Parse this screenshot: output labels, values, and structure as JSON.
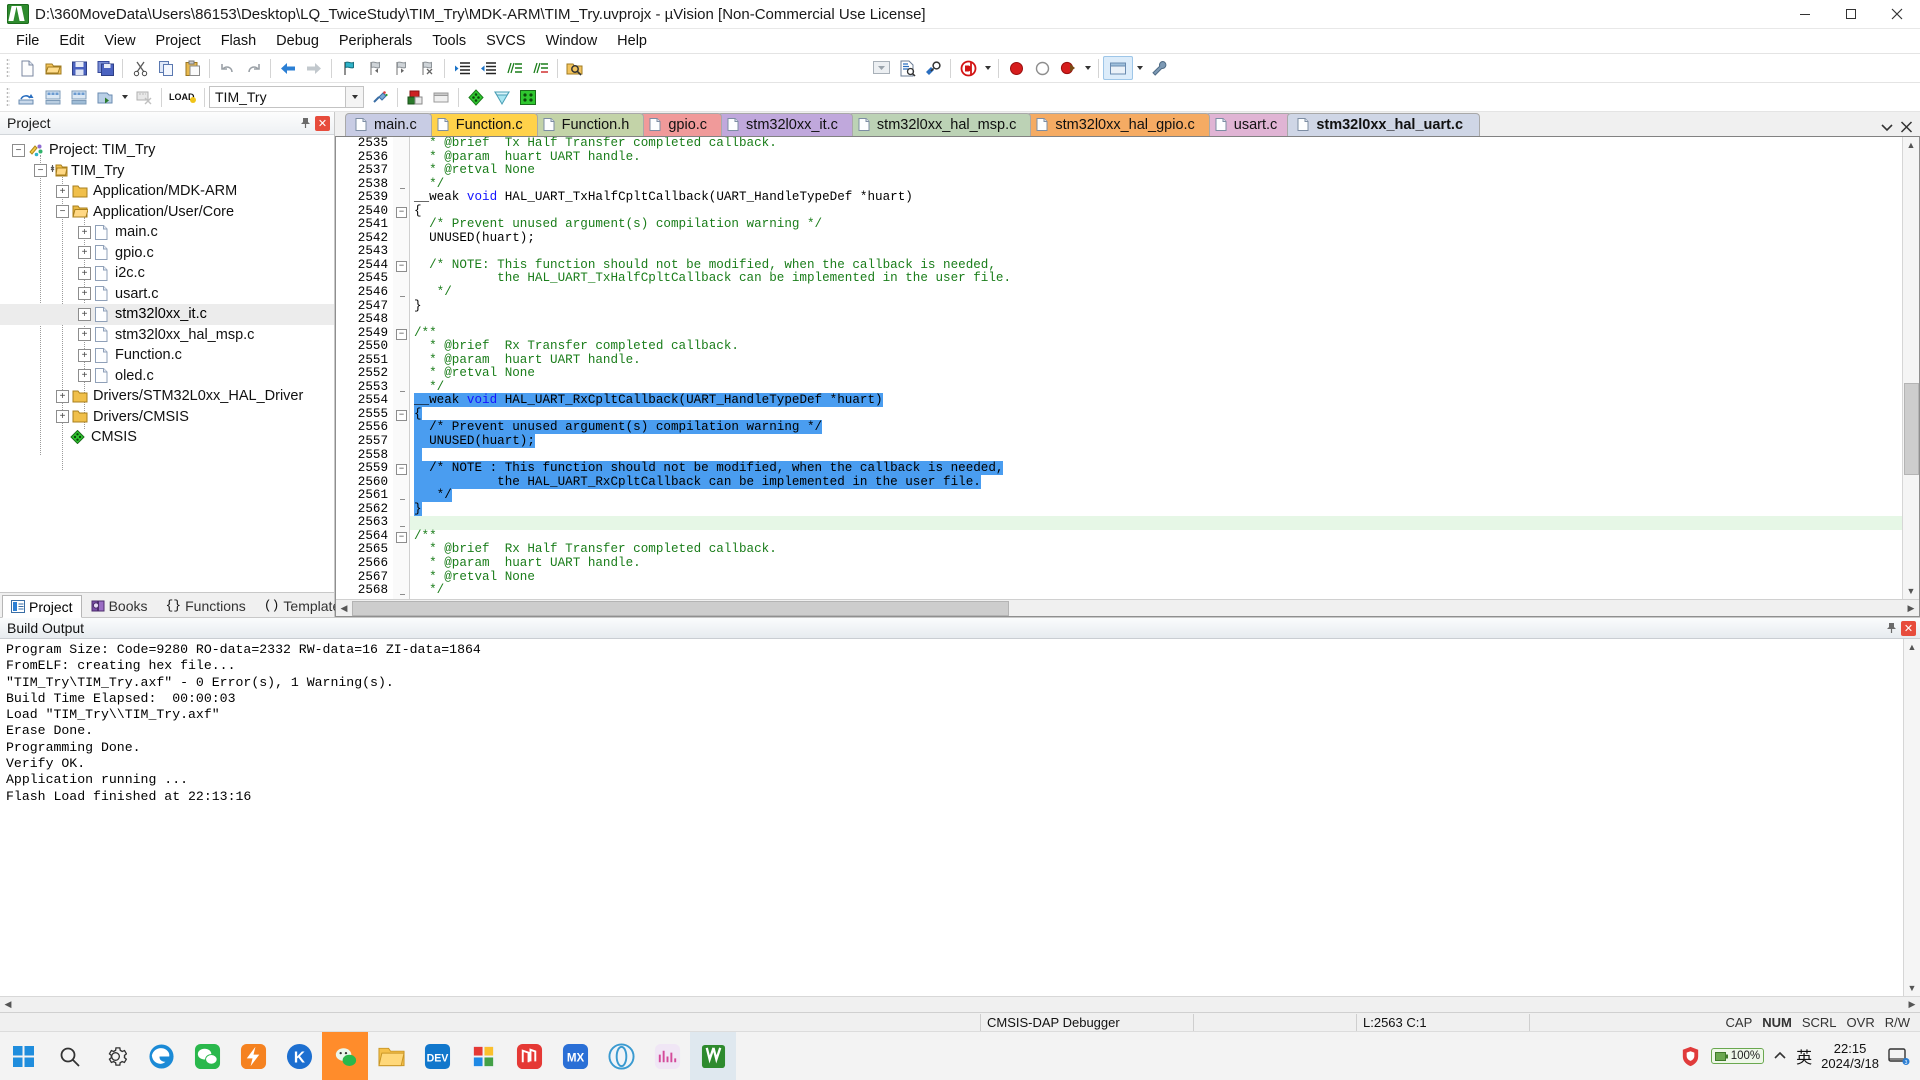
{
  "window": {
    "title": "D:\\360MoveData\\Users\\86153\\Desktop\\LQ_TwiceStudy\\TIM_Try\\MDK-ARM\\TIM_Try.uvprojx - µVision  [Non-Commercial Use License]",
    "app_icon": "uvision-icon",
    "minimize": "─",
    "maximize": "☐",
    "close": "✕"
  },
  "menu": [
    {
      "label": "File",
      "accel": "F"
    },
    {
      "label": "Edit",
      "accel": "E"
    },
    {
      "label": "View",
      "accel": "V"
    },
    {
      "label": "Project",
      "accel": "P"
    },
    {
      "label": "Flash",
      "accel": "l"
    },
    {
      "label": "Debug",
      "accel": "D"
    },
    {
      "label": "Peripherals",
      "accel": "e"
    },
    {
      "label": "Tools",
      "accel": "T"
    },
    {
      "label": "SVCS",
      "accel": "S"
    },
    {
      "label": "Window",
      "accel": "W"
    },
    {
      "label": "Help",
      "accel": "H"
    }
  ],
  "toolbar_main": [
    {
      "name": "new-file-icon"
    },
    {
      "name": "open-file-icon"
    },
    {
      "name": "save-icon"
    },
    {
      "name": "save-all-icon"
    },
    {
      "sep": true
    },
    {
      "name": "cut-icon"
    },
    {
      "name": "copy-icon"
    },
    {
      "name": "paste-icon"
    },
    {
      "sep": true
    },
    {
      "name": "undo-icon"
    },
    {
      "name": "redo-icon"
    },
    {
      "sep": true
    },
    {
      "name": "navigate-back-icon"
    },
    {
      "name": "navigate-forward-icon"
    },
    {
      "sep": true
    },
    {
      "name": "toggle-bookmark-icon"
    },
    {
      "name": "previous-bookmark-icon"
    },
    {
      "name": "next-bookmark-icon"
    },
    {
      "name": "clear-bookmarks-icon"
    },
    {
      "sep": true
    },
    {
      "name": "indent-right-icon"
    },
    {
      "name": "indent-left-icon"
    },
    {
      "name": "comment-lines-icon"
    },
    {
      "name": "uncomment-lines-icon"
    },
    {
      "sep": true
    },
    {
      "name": "find-in-files-icon"
    }
  ],
  "toolbar_main_right": [
    {
      "name": "insert-include-icon"
    },
    {
      "name": "configuration-wizard-icon"
    },
    {
      "name": "find-icon"
    },
    {
      "sep": true
    },
    {
      "name": "debug-session-icon",
      "dropdown": true
    },
    {
      "sep": true
    },
    {
      "name": "breakpoint-icon"
    },
    {
      "name": "disable-breakpoint-icon"
    },
    {
      "name": "kill-breakpoints-icon",
      "dropdown": true
    },
    {
      "sep": true
    },
    {
      "name": "manage-components-icon",
      "dropdown": true
    },
    {
      "name": "configure-icon"
    }
  ],
  "toolbar_project": [
    {
      "name": "translate-icon"
    },
    {
      "name": "build-target-icon"
    },
    {
      "name": "rebuild-all-icon"
    },
    {
      "name": "batch-build-icon",
      "dropdown": true
    },
    {
      "name": "stop-build-icon"
    },
    {
      "sep": true
    },
    {
      "name": "download-icon"
    },
    {
      "sep": true
    },
    {
      "name": "target-selector",
      "value": "TIM_Try",
      "dropdown": true
    },
    {
      "name": "target-options-icon"
    },
    {
      "sep": true
    },
    {
      "name": "manage-project-items-icon"
    },
    {
      "name": "manage-run-time-env-icon"
    },
    {
      "sep": true
    },
    {
      "name": "pack-installer-icon"
    },
    {
      "name": "pack-icon"
    },
    {
      "name": "manage-pack-icon"
    }
  ],
  "project_pane": {
    "header": "Project",
    "pin_icon": "pin-icon",
    "close_icon": "close-icon",
    "tree": [
      {
        "depth": 0,
        "label": "Project: TIM_Try",
        "state": "expanded",
        "icon": "project-icon"
      },
      {
        "depth": 1,
        "label": "TIM_Try",
        "state": "expanded",
        "icon": "target-icon"
      },
      {
        "depth": 2,
        "label": "Application/MDK-ARM",
        "state": "collapsed",
        "icon": "folder-icon"
      },
      {
        "depth": 2,
        "label": "Application/User/Core",
        "state": "expanded",
        "icon": "folder-open-icon"
      },
      {
        "depth": 3,
        "label": "main.c",
        "state": "collapsed",
        "icon": "file-icon"
      },
      {
        "depth": 3,
        "label": "gpio.c",
        "state": "collapsed",
        "icon": "file-icon"
      },
      {
        "depth": 3,
        "label": "i2c.c",
        "state": "collapsed",
        "icon": "file-icon"
      },
      {
        "depth": 3,
        "label": "usart.c",
        "state": "collapsed",
        "icon": "file-icon"
      },
      {
        "depth": 3,
        "label": "stm32l0xx_it.c",
        "state": "collapsed",
        "icon": "file-icon",
        "selected": true
      },
      {
        "depth": 3,
        "label": "stm32l0xx_hal_msp.c",
        "state": "collapsed",
        "icon": "file-icon"
      },
      {
        "depth": 3,
        "label": "Function.c",
        "state": "collapsed",
        "icon": "file-icon"
      },
      {
        "depth": 3,
        "label": "oled.c",
        "state": "collapsed",
        "icon": "file-icon"
      },
      {
        "depth": 2,
        "label": "Drivers/STM32L0xx_HAL_Driver",
        "state": "collapsed",
        "icon": "folder-icon"
      },
      {
        "depth": 2,
        "label": "Drivers/CMSIS",
        "state": "collapsed",
        "icon": "folder-icon"
      },
      {
        "depth": 2,
        "label": "CMSIS",
        "state": "leaf",
        "icon": "cmsis-icon"
      }
    ],
    "tabs": [
      {
        "label": "Project",
        "icon": "project-tab-icon",
        "active": true
      },
      {
        "label": "Books",
        "icon": "books-icon",
        "active": false
      },
      {
        "label": "Functions",
        "icon": "functions-icon",
        "active": false
      },
      {
        "label": "Templates",
        "icon": "templates-icon",
        "active": false
      }
    ]
  },
  "editor": {
    "tabs": [
      {
        "label": "main.c",
        "color": "#c8cce4",
        "active": false
      },
      {
        "label": "Function.c",
        "color": "#ffd24a",
        "active": false
      },
      {
        "label": "Function.h",
        "color": "#c3d3a8",
        "active": false
      },
      {
        "label": "gpio.c",
        "color": "#f09a9a",
        "active": false
      },
      {
        "label": "stm32l0xx_it.c",
        "color": "#c0a8dc",
        "active": false
      },
      {
        "label": "stm32l0xx_hal_msp.c",
        "color": "#bcd2b5",
        "active": false
      },
      {
        "label": "stm32l0xx_hal_gpio.c",
        "color": "#f5ab63",
        "active": false
      },
      {
        "label": "usart.c",
        "color": "#e0b4d4",
        "active": false
      },
      {
        "label": "stm32l0xx_hal_uart.c",
        "color": "#cfd6e6",
        "active": true
      }
    ],
    "tab_menu_icon": "tab-list-icon",
    "tab_close_icon": "close-icon",
    "first_line_number": 2535,
    "lines": [
      {
        "n": 2535,
        "fold": "",
        "text": "  * @brief  Tx Half Transfer completed callback.",
        "style": "comment"
      },
      {
        "n": 2536,
        "fold": "",
        "text": "  * @param  huart UART handle.",
        "style": "comment"
      },
      {
        "n": 2537,
        "fold": "",
        "text": "  * @retval None",
        "style": "comment"
      },
      {
        "n": 2538,
        "fold": "end",
        "text": "  */",
        "style": "comment"
      },
      {
        "n": 2539,
        "fold": "",
        "text": "__weak void HAL_UART_TxHalfCpltCallback(UART_HandleTypeDef *huart)",
        "style": "code-weak"
      },
      {
        "n": 2540,
        "fold": "open",
        "text": "{",
        "style": "plain"
      },
      {
        "n": 2541,
        "fold": "",
        "text": "  /* Prevent unused argument(s) compilation warning */",
        "style": "comment"
      },
      {
        "n": 2542,
        "fold": "",
        "text": "  UNUSED(huart);",
        "style": "plain"
      },
      {
        "n": 2543,
        "fold": "",
        "text": "",
        "style": "plain"
      },
      {
        "n": 2544,
        "fold": "open",
        "text": "  /* NOTE: This function should not be modified, when the callback is needed,",
        "style": "comment"
      },
      {
        "n": 2545,
        "fold": "",
        "text": "           the HAL_UART_TxHalfCpltCallback can be implemented in the user file.",
        "style": "comment"
      },
      {
        "n": 2546,
        "fold": "end",
        "text": "   */",
        "style": "comment"
      },
      {
        "n": 2547,
        "fold": "",
        "text": "}",
        "style": "plain"
      },
      {
        "n": 2548,
        "fold": "",
        "text": "",
        "style": "plain"
      },
      {
        "n": 2549,
        "fold": "open",
        "text": "/**",
        "style": "comment"
      },
      {
        "n": 2550,
        "fold": "",
        "text": "  * @brief  Rx Transfer completed callback.",
        "style": "comment"
      },
      {
        "n": 2551,
        "fold": "",
        "text": "  * @param  huart UART handle.",
        "style": "comment"
      },
      {
        "n": 2552,
        "fold": "",
        "text": "  * @retval None",
        "style": "comment"
      },
      {
        "n": 2553,
        "fold": "end",
        "text": "  */",
        "style": "comment"
      },
      {
        "n": 2554,
        "fold": "",
        "text": "__weak void HAL_UART_RxCpltCallback(UART_HandleTypeDef *huart)",
        "style": "selected-weak"
      },
      {
        "n": 2555,
        "fold": "open",
        "text": "{",
        "style": "selected"
      },
      {
        "n": 2556,
        "fold": "",
        "text": "  /* Prevent unused argument(s) compilation warning */",
        "style": "selected"
      },
      {
        "n": 2557,
        "fold": "",
        "text": "  UNUSED(huart);",
        "style": "selected"
      },
      {
        "n": 2558,
        "fold": "",
        "text": "",
        "style": "selected"
      },
      {
        "n": 2559,
        "fold": "open",
        "text": "  /* NOTE : This function should not be modified, when the callback is needed,",
        "style": "selected"
      },
      {
        "n": 2560,
        "fold": "",
        "text": "           the HAL_UART_RxCpltCallback can be implemented in the user file.",
        "style": "selected"
      },
      {
        "n": 2561,
        "fold": "end",
        "text": "   */",
        "style": "selected"
      },
      {
        "n": 2562,
        "fold": "",
        "text": "}",
        "style": "selected"
      },
      {
        "n": 2563,
        "fold": "end",
        "text": "",
        "style": "current"
      },
      {
        "n": 2564,
        "fold": "open",
        "text": "/**",
        "style": "comment"
      },
      {
        "n": 2565,
        "fold": "",
        "text": "  * @brief  Rx Half Transfer completed callback.",
        "style": "comment"
      },
      {
        "n": 2566,
        "fold": "",
        "text": "  * @param  huart UART handle.",
        "style": "comment"
      },
      {
        "n": 2567,
        "fold": "",
        "text": "  * @retval None",
        "style": "comment"
      },
      {
        "n": 2568,
        "fold": "end",
        "text": "  */",
        "style": "comment"
      }
    ]
  },
  "build_output": {
    "header": "Build Output",
    "pin_icon": "pin-icon",
    "close_icon": "close-icon",
    "lines": [
      "Program Size: Code=9280 RO-data=2332 RW-data=16 ZI-data=1864",
      "FromELF: creating hex file...",
      "\"TIM_Try\\TIM_Try.axf\" - 0 Error(s), 1 Warning(s).",
      "Build Time Elapsed:  00:00:03",
      "Load \"TIM_Try\\\\TIM_Try.axf\"",
      "Erase Done.",
      "Programming Done.",
      "Verify OK.",
      "Application running ...",
      "Flash Load finished at 22:13:16"
    ]
  },
  "statusbar": {
    "debugger": "CMSIS-DAP Debugger",
    "position": "L:2563 C:1",
    "flags": [
      "CAP",
      "NUM",
      "SCRL",
      "OVR",
      "R/W"
    ]
  },
  "taskbar": {
    "items": [
      {
        "name": "start-button-icon"
      },
      {
        "name": "search-icon"
      },
      {
        "name": "settings-icon"
      },
      {
        "name": "edge-browser-icon"
      },
      {
        "name": "wechat-icon"
      },
      {
        "name": "thunder-download-icon"
      },
      {
        "name": "kugou-music-icon"
      },
      {
        "name": "wechat-devtool-icon",
        "active": true
      },
      {
        "name": "file-explorer-icon"
      },
      {
        "name": "dev-editor-icon"
      },
      {
        "name": "quark-icon"
      },
      {
        "name": "netease-music-icon"
      },
      {
        "name": "mx-browser-icon"
      },
      {
        "name": "opera-icon"
      },
      {
        "name": "bilibili-icon"
      },
      {
        "name": "keil-uvision-icon",
        "active": true
      }
    ],
    "tray": {
      "security_icon": "security-shield-icon",
      "battery_percent": "100%",
      "chevron_icon": "show-hidden-icons-icon",
      "ime": "英",
      "time": "22:15",
      "date": "2024/3/18",
      "notification_icon": "notifications-icon"
    }
  }
}
